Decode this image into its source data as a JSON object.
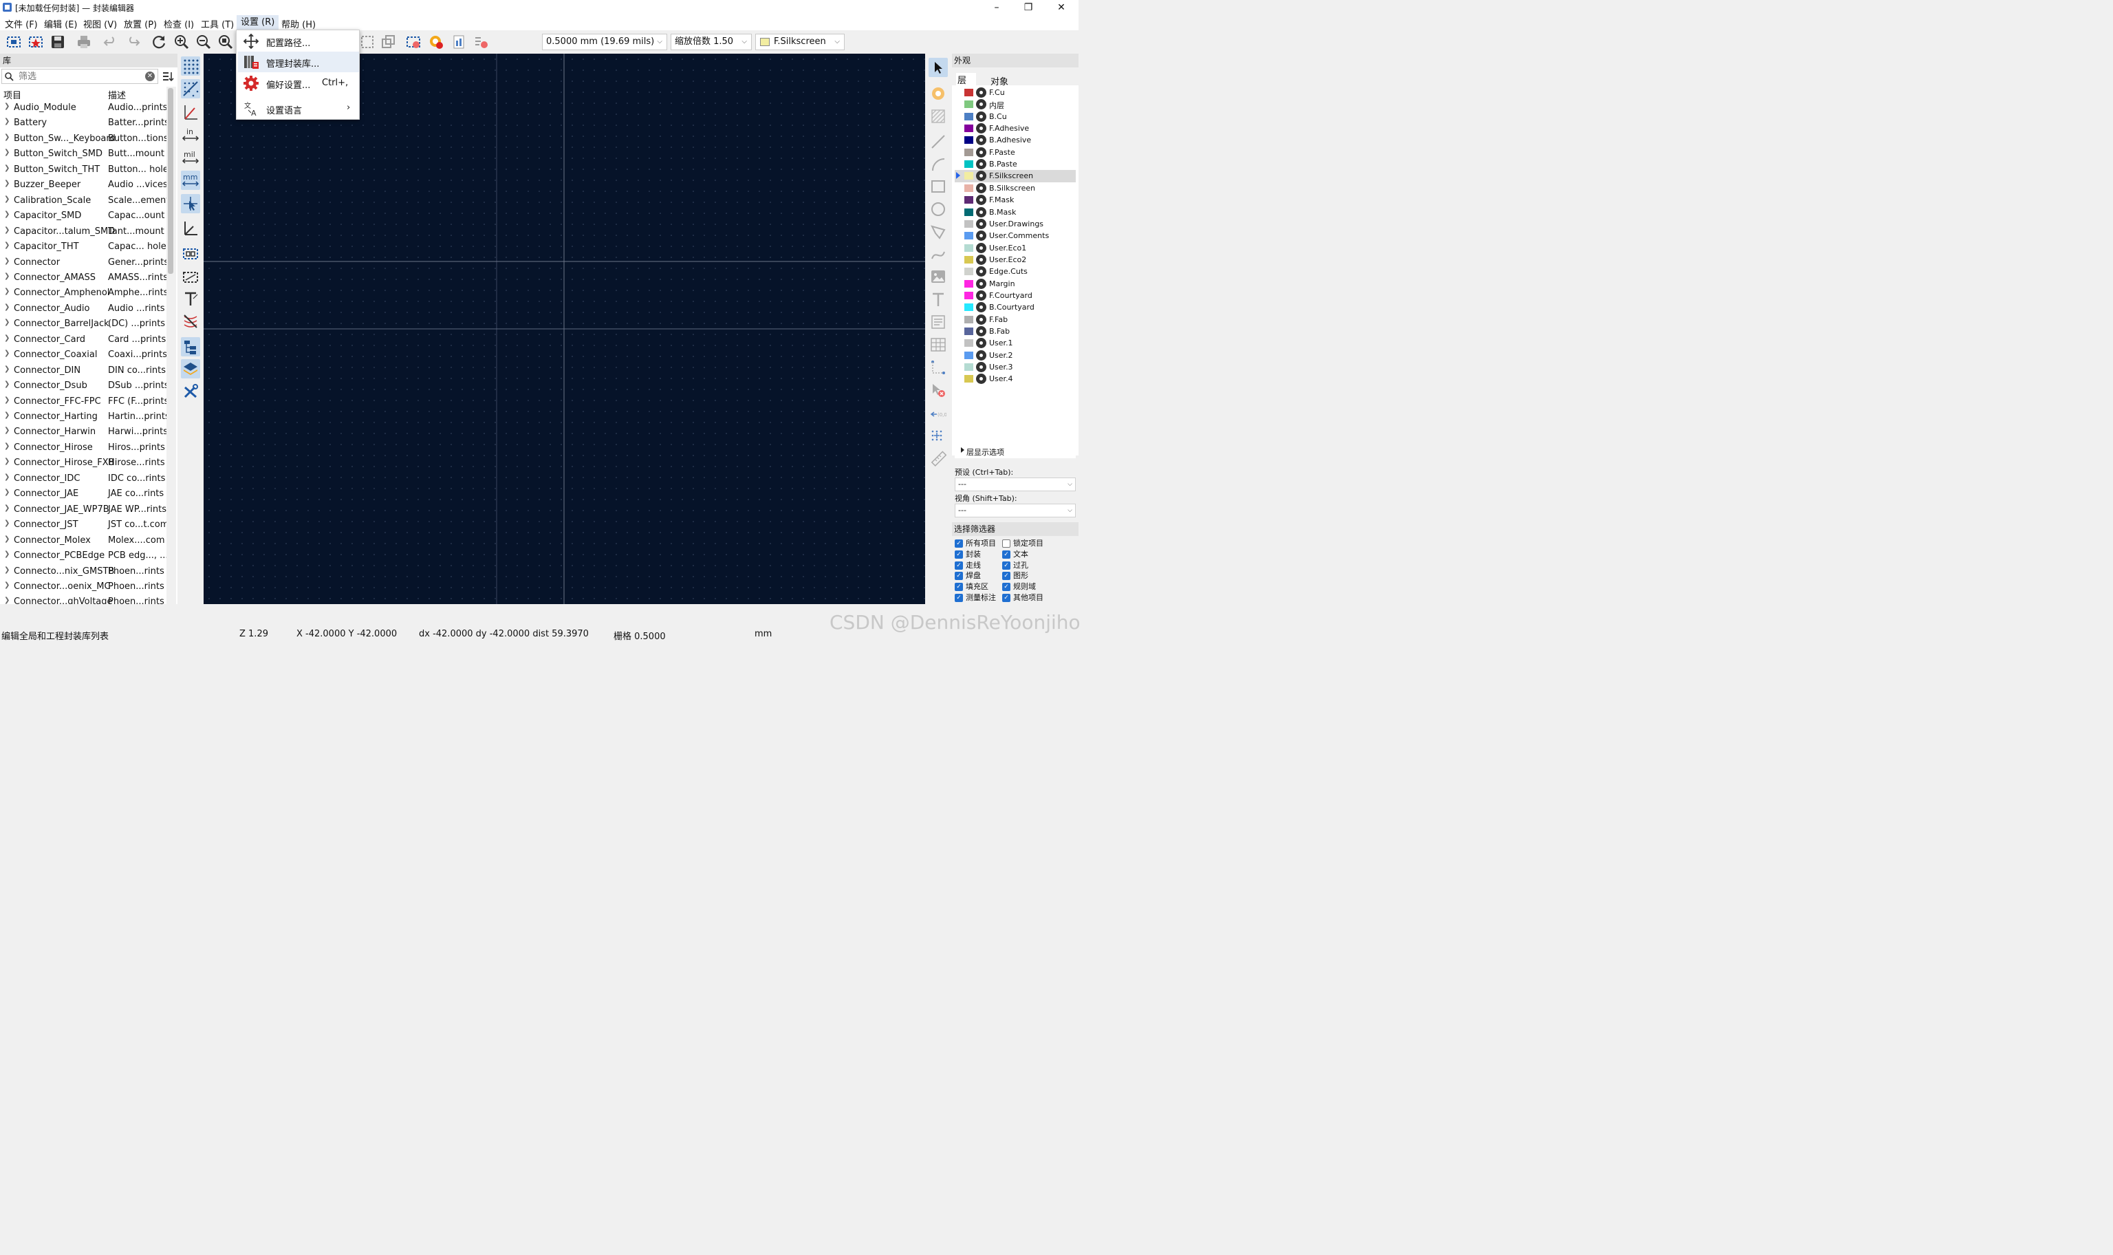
{
  "window": {
    "title": "[未加载任何封装] — 封装编辑器",
    "controls": {
      "minimize": "–",
      "maximize": "❐",
      "close": "✕"
    }
  },
  "menubar": [
    {
      "label": "文件 (F)"
    },
    {
      "label": "编辑 (E)"
    },
    {
      "label": "视图 (V)"
    },
    {
      "label": "放置 (P)"
    },
    {
      "label": "检查 (I)"
    },
    {
      "label": "工具 (T)"
    },
    {
      "label": "设置 (R)"
    },
    {
      "label": "帮助 (H)"
    }
  ],
  "toolbar": {
    "grid_value": "0.5000 mm (19.69 mils)",
    "zoom_value": "缩放倍数 1.50",
    "layer_value": "F.Silkscreen"
  },
  "settings_menu": [
    {
      "label": "配置路径...",
      "shortcut": ""
    },
    {
      "label": "管理封装库...",
      "shortcut": ""
    },
    {
      "label": "偏好设置...",
      "shortcut": "Ctrl+,"
    },
    {
      "label": "设置语言",
      "shortcut": "›"
    }
  ],
  "library": {
    "title": "库",
    "filter_placeholder": "筛选",
    "col_name": "项目",
    "col_desc": "描述",
    "rows": [
      {
        "name": "Audio_Module",
        "desc": "Audio...prints"
      },
      {
        "name": "Battery",
        "desc": "Batter...prints"
      },
      {
        "name": "Button_Sw..._Keyboard",
        "desc": "Button...tions"
      },
      {
        "name": "Button_Switch_SMD",
        "desc": "Butt...mount"
      },
      {
        "name": "Button_Switch_THT",
        "desc": "Button... hole"
      },
      {
        "name": "Buzzer_Beeper",
        "desc": "Audio ...vices"
      },
      {
        "name": "Calibration_Scale",
        "desc": "Scale...ement"
      },
      {
        "name": "Capacitor_SMD",
        "desc": "Capac...ount"
      },
      {
        "name": "Capacitor...talum_SMD",
        "desc": "Tant...mount"
      },
      {
        "name": "Capacitor_THT",
        "desc": "Capac... hole"
      },
      {
        "name": "Connector",
        "desc": "Gener...prints"
      },
      {
        "name": "Connector_AMASS",
        "desc": "AMASS...rints"
      },
      {
        "name": "Connector_Amphenol",
        "desc": "Amphe...rints"
      },
      {
        "name": "Connector_Audio",
        "desc": "Audio ...rints"
      },
      {
        "name": "Connector_BarrelJack",
        "desc": "(DC) ...prints"
      },
      {
        "name": "Connector_Card",
        "desc": "Card ...prints"
      },
      {
        "name": "Connector_Coaxial",
        "desc": "Coaxi...prints"
      },
      {
        "name": "Connector_DIN",
        "desc": "DIN co...rints"
      },
      {
        "name": "Connector_Dsub",
        "desc": "DSub ...prints"
      },
      {
        "name": "Connector_FFC-FPC",
        "desc": "FFC (F...prints"
      },
      {
        "name": "Connector_Harting",
        "desc": "Hartin...prints"
      },
      {
        "name": "Connector_Harwin",
        "desc": "Harwi...prints"
      },
      {
        "name": "Connector_Hirose",
        "desc": "Hiros...prints"
      },
      {
        "name": "Connector_Hirose_FX8",
        "desc": "Hirose...rints"
      },
      {
        "name": "Connector_IDC",
        "desc": "IDC co...rints"
      },
      {
        "name": "Connector_JAE",
        "desc": "JAE co...rints"
      },
      {
        "name": "Connector_JAE_WP7B",
        "desc": "JAE WP...rints"
      },
      {
        "name": "Connector_JST",
        "desc": "JST co...t.com"
      },
      {
        "name": "Connector_Molex",
        "desc": "Molex....com"
      },
      {
        "name": "Connector_PCBEdge",
        "desc": "PCB edg..., ...)"
      },
      {
        "name": "Connecto...nix_GMSTB",
        "desc": "Phoen...rints"
      },
      {
        "name": "Connector...oenix_MC",
        "desc": "Phoen...rints"
      },
      {
        "name": "Connector...ghVoltage",
        "desc": "Phoen...rints"
      }
    ]
  },
  "appearance": {
    "title": "外观",
    "tabs": [
      {
        "label": "层"
      },
      {
        "label": "对象"
      }
    ],
    "layers": [
      {
        "name": "F.Cu",
        "color": "#c83434"
      },
      {
        "name": "内层",
        "color": "#7fc87f"
      },
      {
        "name": "B.Cu",
        "color": "#4d7fc4"
      },
      {
        "name": "F.Adhesive",
        "color": "#84009c"
      },
      {
        "name": "B.Adhesive",
        "color": "#000084"
      },
      {
        "name": "F.Paste",
        "color": "#a39a94"
      },
      {
        "name": "B.Paste",
        "color": "#00c2c2"
      },
      {
        "name": "F.Silkscreen",
        "color": "#f2eda1"
      },
      {
        "name": "B.Silkscreen",
        "color": "#e8b2a7"
      },
      {
        "name": "F.Mask",
        "color": "#5e2a74"
      },
      {
        "name": "B.Mask",
        "color": "#036b73"
      },
      {
        "name": "User.Drawings",
        "color": "#c2c2c2"
      },
      {
        "name": "User.Comments",
        "color": "#5a9bf0"
      },
      {
        "name": "User.Eco1",
        "color": "#b4dbd2"
      },
      {
        "name": "User.Eco2",
        "color": "#d8c852"
      },
      {
        "name": "Edge.Cuts",
        "color": "#d0d2cd"
      },
      {
        "name": "Margin",
        "color": "#ff26e2"
      },
      {
        "name": "F.Courtyard",
        "color": "#ff26e2"
      },
      {
        "name": "B.Courtyard",
        "color": "#26e9ff"
      },
      {
        "name": "F.Fab",
        "color": "#afafaf"
      },
      {
        "name": "B.Fab",
        "color": "#58659b"
      },
      {
        "name": "User.1",
        "color": "#c2c2c2"
      },
      {
        "name": "User.2",
        "color": "#5a9bf0"
      },
      {
        "name": "User.3",
        "color": "#b4dbd2"
      },
      {
        "name": "User.4",
        "color": "#d8c852"
      }
    ],
    "selected_layer": "F.Silkscreen",
    "layer_options": "层显示选项",
    "preset_label": "预设 (Ctrl+Tab):",
    "preset_value": "---",
    "viewport_label": "视角 (Shift+Tab):",
    "viewport_value": "---"
  },
  "selection_filter": {
    "title": "选择筛选器",
    "items": [
      {
        "label": "所有项目",
        "checked": true
      },
      {
        "label": "锁定项目",
        "checked": false
      },
      {
        "label": "封装",
        "checked": true
      },
      {
        "label": "文本",
        "checked": true
      },
      {
        "label": "走线",
        "checked": true
      },
      {
        "label": "过孔",
        "checked": true
      },
      {
        "label": "焊盘",
        "checked": true
      },
      {
        "label": "图形",
        "checked": true
      },
      {
        "label": "填充区",
        "checked": true
      },
      {
        "label": "规则域",
        "checked": true
      },
      {
        "label": "测量标注",
        "checked": true
      },
      {
        "label": "其他项目",
        "checked": true
      }
    ]
  },
  "status": {
    "hint": "编辑全局和工程封装库列表",
    "zoom": "Z 1.29",
    "xy": "X -42.0000  Y -42.0000",
    "dxdy": "dx -42.0000  dy -42.0000  dist 59.3970",
    "grid": "栅格 0.5000",
    "units": "mm"
  },
  "watermark": "CSDN @DennisReYoonjiho",
  "colors": {
    "canvas": "#061329",
    "accent": "#1f6fd1"
  }
}
